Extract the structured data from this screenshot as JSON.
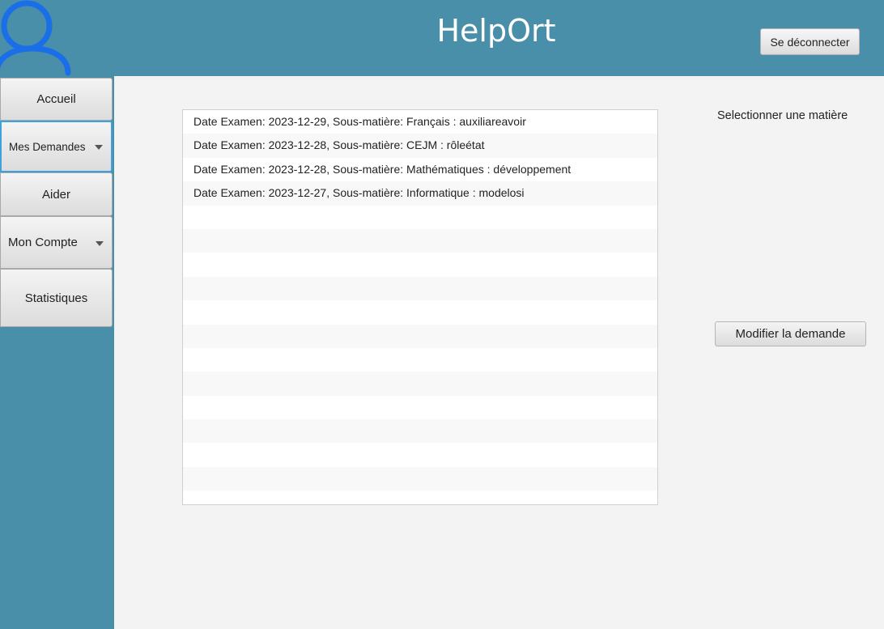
{
  "header": {
    "title": "HelpOrt",
    "logout_label": "Se déconnecter"
  },
  "sidebar": {
    "items": [
      {
        "label": "Accueil",
        "dropdown": false
      },
      {
        "label": "Mes Demandes",
        "dropdown": true,
        "selected": true
      },
      {
        "label": "Aider",
        "dropdown": false
      },
      {
        "label": "Mon Compte",
        "dropdown": true
      },
      {
        "label": "Statistiques",
        "dropdown": false
      }
    ]
  },
  "requests": [
    "Date Examen: 2023-12-29, Sous-matière: Français : auxiliareavoir",
    "Date Examen: 2023-12-28, Sous-matière: CEJM : rôleétat",
    "Date Examen: 2023-12-28, Sous-matière: Mathématiques : développement",
    "Date Examen: 2023-12-27, Sous-matière: Informatique : modelosi"
  ],
  "panel": {
    "select_label": "Selectionner une matière",
    "modify_label": "Modifier la demande"
  },
  "colors": {
    "header_bg": "#4a8fa9",
    "main_bg": "#f3f3f3",
    "avatar_blue": "#1a6ee8",
    "selected_border": "#3ea0dc"
  },
  "icons": {
    "avatar": "user-avatar-icon",
    "dropdown": "chevron-down-icon"
  }
}
